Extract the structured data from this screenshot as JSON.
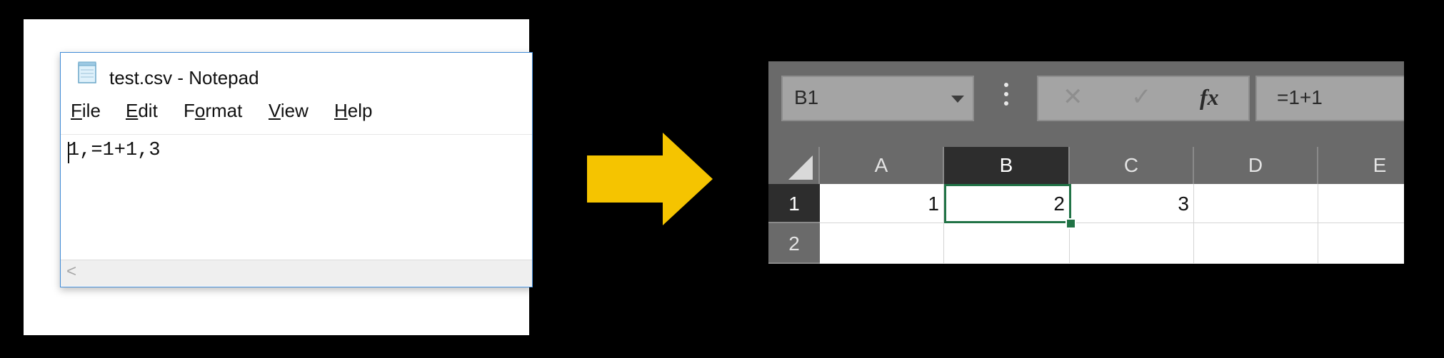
{
  "notepad": {
    "title": "test.csv - Notepad",
    "icon": "notepad-icon",
    "menu": [
      {
        "label": "File",
        "mnemonic": "F",
        "rest": "ile"
      },
      {
        "label": "Edit",
        "mnemonic": "E",
        "rest": "dit"
      },
      {
        "label": "Format",
        "before": "F",
        "mnemonic": "o",
        "rest": "rmat"
      },
      {
        "label": "View",
        "mnemonic": "V",
        "rest": "iew"
      },
      {
        "label": "Help",
        "mnemonic": "H",
        "rest": "elp"
      }
    ],
    "content": "1,=1+1,3",
    "scroll_left_glyph": "<"
  },
  "arrow": {
    "icon": "right-arrow-icon",
    "color": "#f5c400"
  },
  "excel": {
    "name_box": "B1",
    "formula_buttons": {
      "cancel": "✕",
      "enter": "✓",
      "insert_function": "fx"
    },
    "formula": "=1+1",
    "columns": [
      "A",
      "B",
      "C",
      "D",
      "E"
    ],
    "active_column": "B",
    "rows": [
      {
        "header": "1",
        "cells": [
          "1",
          "2",
          "3",
          "",
          ""
        ]
      },
      {
        "header": "2",
        "cells": [
          "",
          "",
          "",
          "",
          ""
        ]
      }
    ],
    "selected_cell": "B1",
    "accent_color": "#217346"
  }
}
